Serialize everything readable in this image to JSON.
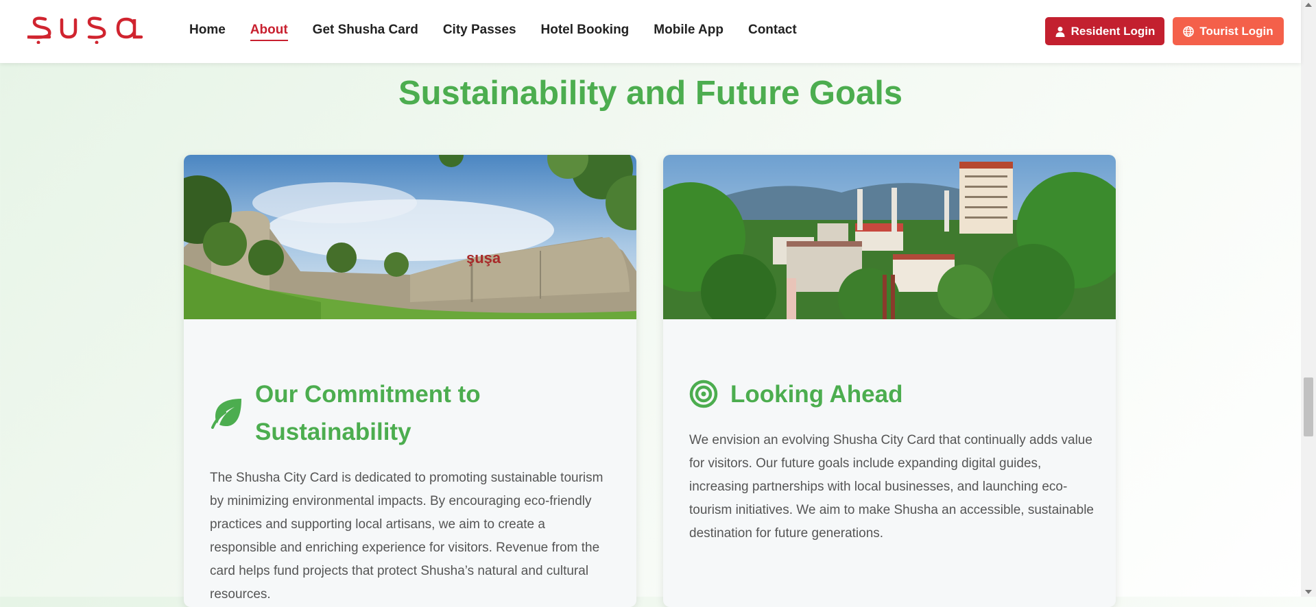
{
  "header": {
    "logo_text": "şuşa",
    "nav": [
      {
        "label": "Home",
        "active": false
      },
      {
        "label": "About",
        "active": true
      },
      {
        "label": "Get Shusha Card",
        "active": false
      },
      {
        "label": "City Passes",
        "active": false
      },
      {
        "label": "Hotel Booking",
        "active": false
      },
      {
        "label": "Mobile App",
        "active": false
      },
      {
        "label": "Contact",
        "active": false
      }
    ],
    "resident_login": "Resident Login",
    "tourist_login": "Tourist Login"
  },
  "section": {
    "title": "Sustainability and Future Goals"
  },
  "cards": [
    {
      "icon": "leaf-icon",
      "title": "Our Commitment to Sustainability",
      "text": "The Shusha City Card is dedicated to promoting sustainable tourism by minimizing environmental impacts. By encouraging eco-friendly practices and supporting local artisans, we aim to create a responsible and enriching experience for visitors. Revenue from the card helps fund projects that protect Shusha’s natural and cultural resources.",
      "image_sign": "şuşa"
    },
    {
      "icon": "bullseye-icon",
      "title": "Looking Ahead",
      "text": "We envision an evolving Shusha City Card that continually adds value for visitors. Our future goals include expanding digital guides, increasing partnerships with local businesses, and launching eco-tourism initiatives. We aim to make Shusha an accessible, sustainable destination for future generations."
    }
  ],
  "colors": {
    "brand_red": "#c3202f",
    "tourist_orange": "#f4604a",
    "accent_green": "#4cad4f"
  }
}
